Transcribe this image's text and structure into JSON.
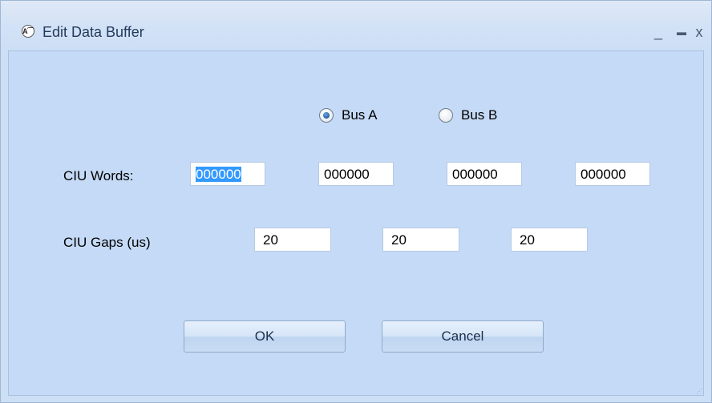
{
  "window": {
    "title": "Edit Data Buffer",
    "app_icon_glyph": "A⁀",
    "minimize_glyph": "_",
    "maximize_glyph": "▬",
    "close_glyph": "x"
  },
  "bus": {
    "options": [
      {
        "label": "Bus A",
        "checked": true
      },
      {
        "label": "Bus B",
        "checked": false
      }
    ]
  },
  "ciu_words": {
    "label": "CIU Words:",
    "values": [
      "000000",
      "000000",
      "000000",
      "000000"
    ]
  },
  "ciu_gaps": {
    "label": "CIU Gaps (us)",
    "values": [
      "20",
      "20",
      "20"
    ]
  },
  "buttons": {
    "ok": "OK",
    "cancel": "Cancel"
  }
}
